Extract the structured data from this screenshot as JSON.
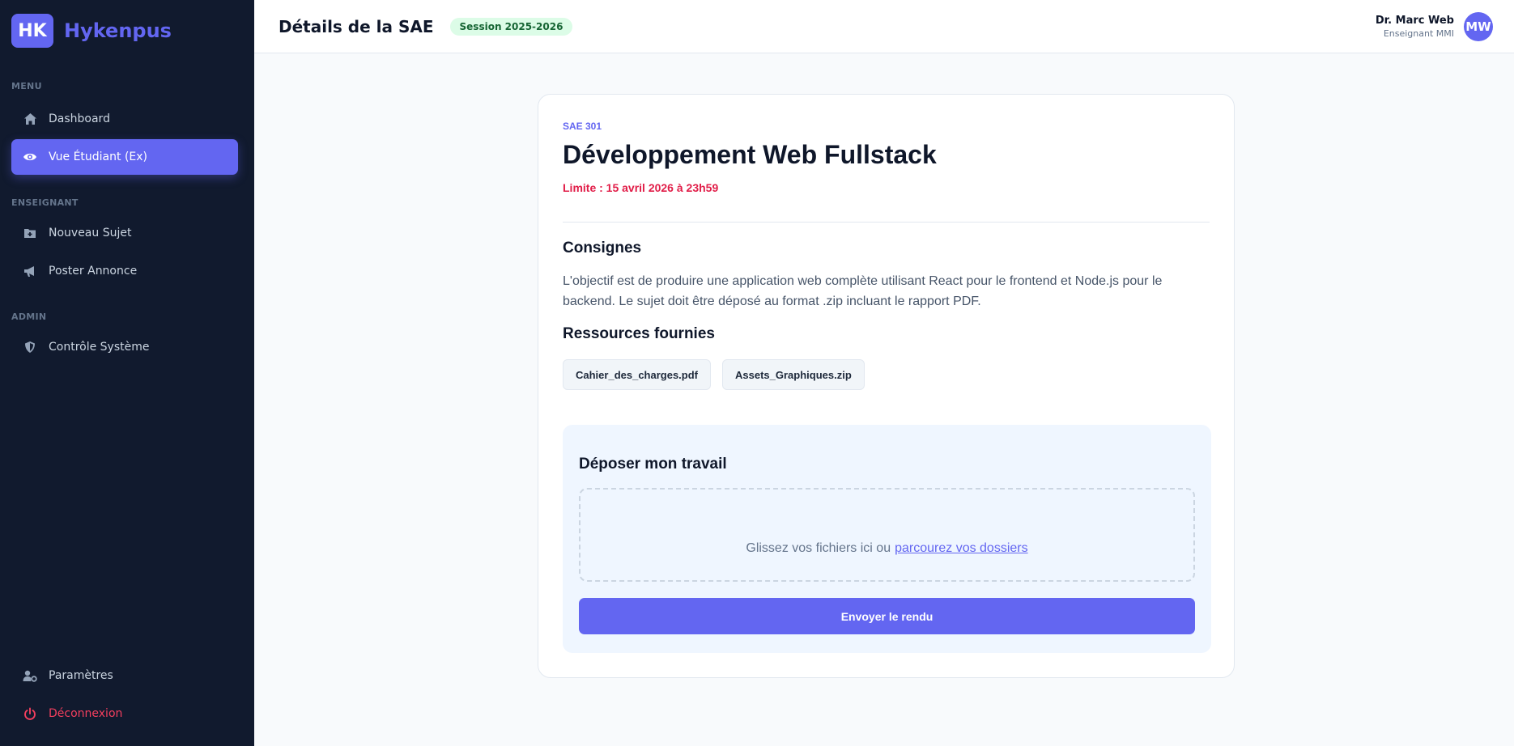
{
  "brand": {
    "logo_text": "HK",
    "name": "Hykenpus"
  },
  "sidebar": {
    "sections": [
      {
        "label": "MENU"
      },
      {
        "label": "ENSEIGNANT"
      },
      {
        "label": "ADMIN"
      }
    ],
    "items": [
      {
        "label": "Dashboard",
        "icon": "home-icon",
        "section": "MENU"
      },
      {
        "label": "Vue Étudiant (Ex)",
        "icon": "eye-icon",
        "section": "MENU",
        "active": true
      },
      {
        "label": "Nouveau Sujet",
        "icon": "folder-plus-icon",
        "section": "ENSEIGNANT"
      },
      {
        "label": "Poster Annonce",
        "icon": "megaphone-icon",
        "section": "ENSEIGNANT"
      },
      {
        "label": "Contrôle Système",
        "icon": "shield-icon",
        "section": "ADMIN"
      }
    ],
    "bottom": [
      {
        "label": "Paramètres",
        "icon": "user-gear-icon"
      },
      {
        "label": "Déconnexion",
        "icon": "power-icon",
        "color": "#f43f5e"
      }
    ]
  },
  "header": {
    "title": "Détails de la SAE",
    "session_badge": "Session 2025-2026",
    "user": {
      "name": "Dr. Marc Web",
      "role": "Enseignant MMI",
      "initials": "MW"
    }
  },
  "sae": {
    "code": "SAE 301",
    "title": "Développement Web Fullstack",
    "deadline": "Limite : 15 avril 2026 à 23h59",
    "instructions_heading": "Consignes",
    "instructions": "L'objectif est de produire une application web complète utilisant React pour le frontend et Node.js pour le backend. Le sujet doit être déposé au format .zip incluant le rapport PDF.",
    "resources_heading": "Ressources fournies",
    "resources": [
      "Cahier_des_charges.pdf",
      "Assets_Graphiques.zip"
    ]
  },
  "submission": {
    "heading": "Déposer mon travail",
    "dropzone_text": "Glissez vos fichiers ici ou",
    "dropzone_link": "parcourez vos dossiers",
    "submit_label": "Envoyer le rendu"
  },
  "colors": {
    "sidebar_bg": "#111a2e",
    "accent": "#6366f1",
    "danger": "#e11d48",
    "badge_bg": "#dcfce7",
    "badge_text": "#166534"
  }
}
